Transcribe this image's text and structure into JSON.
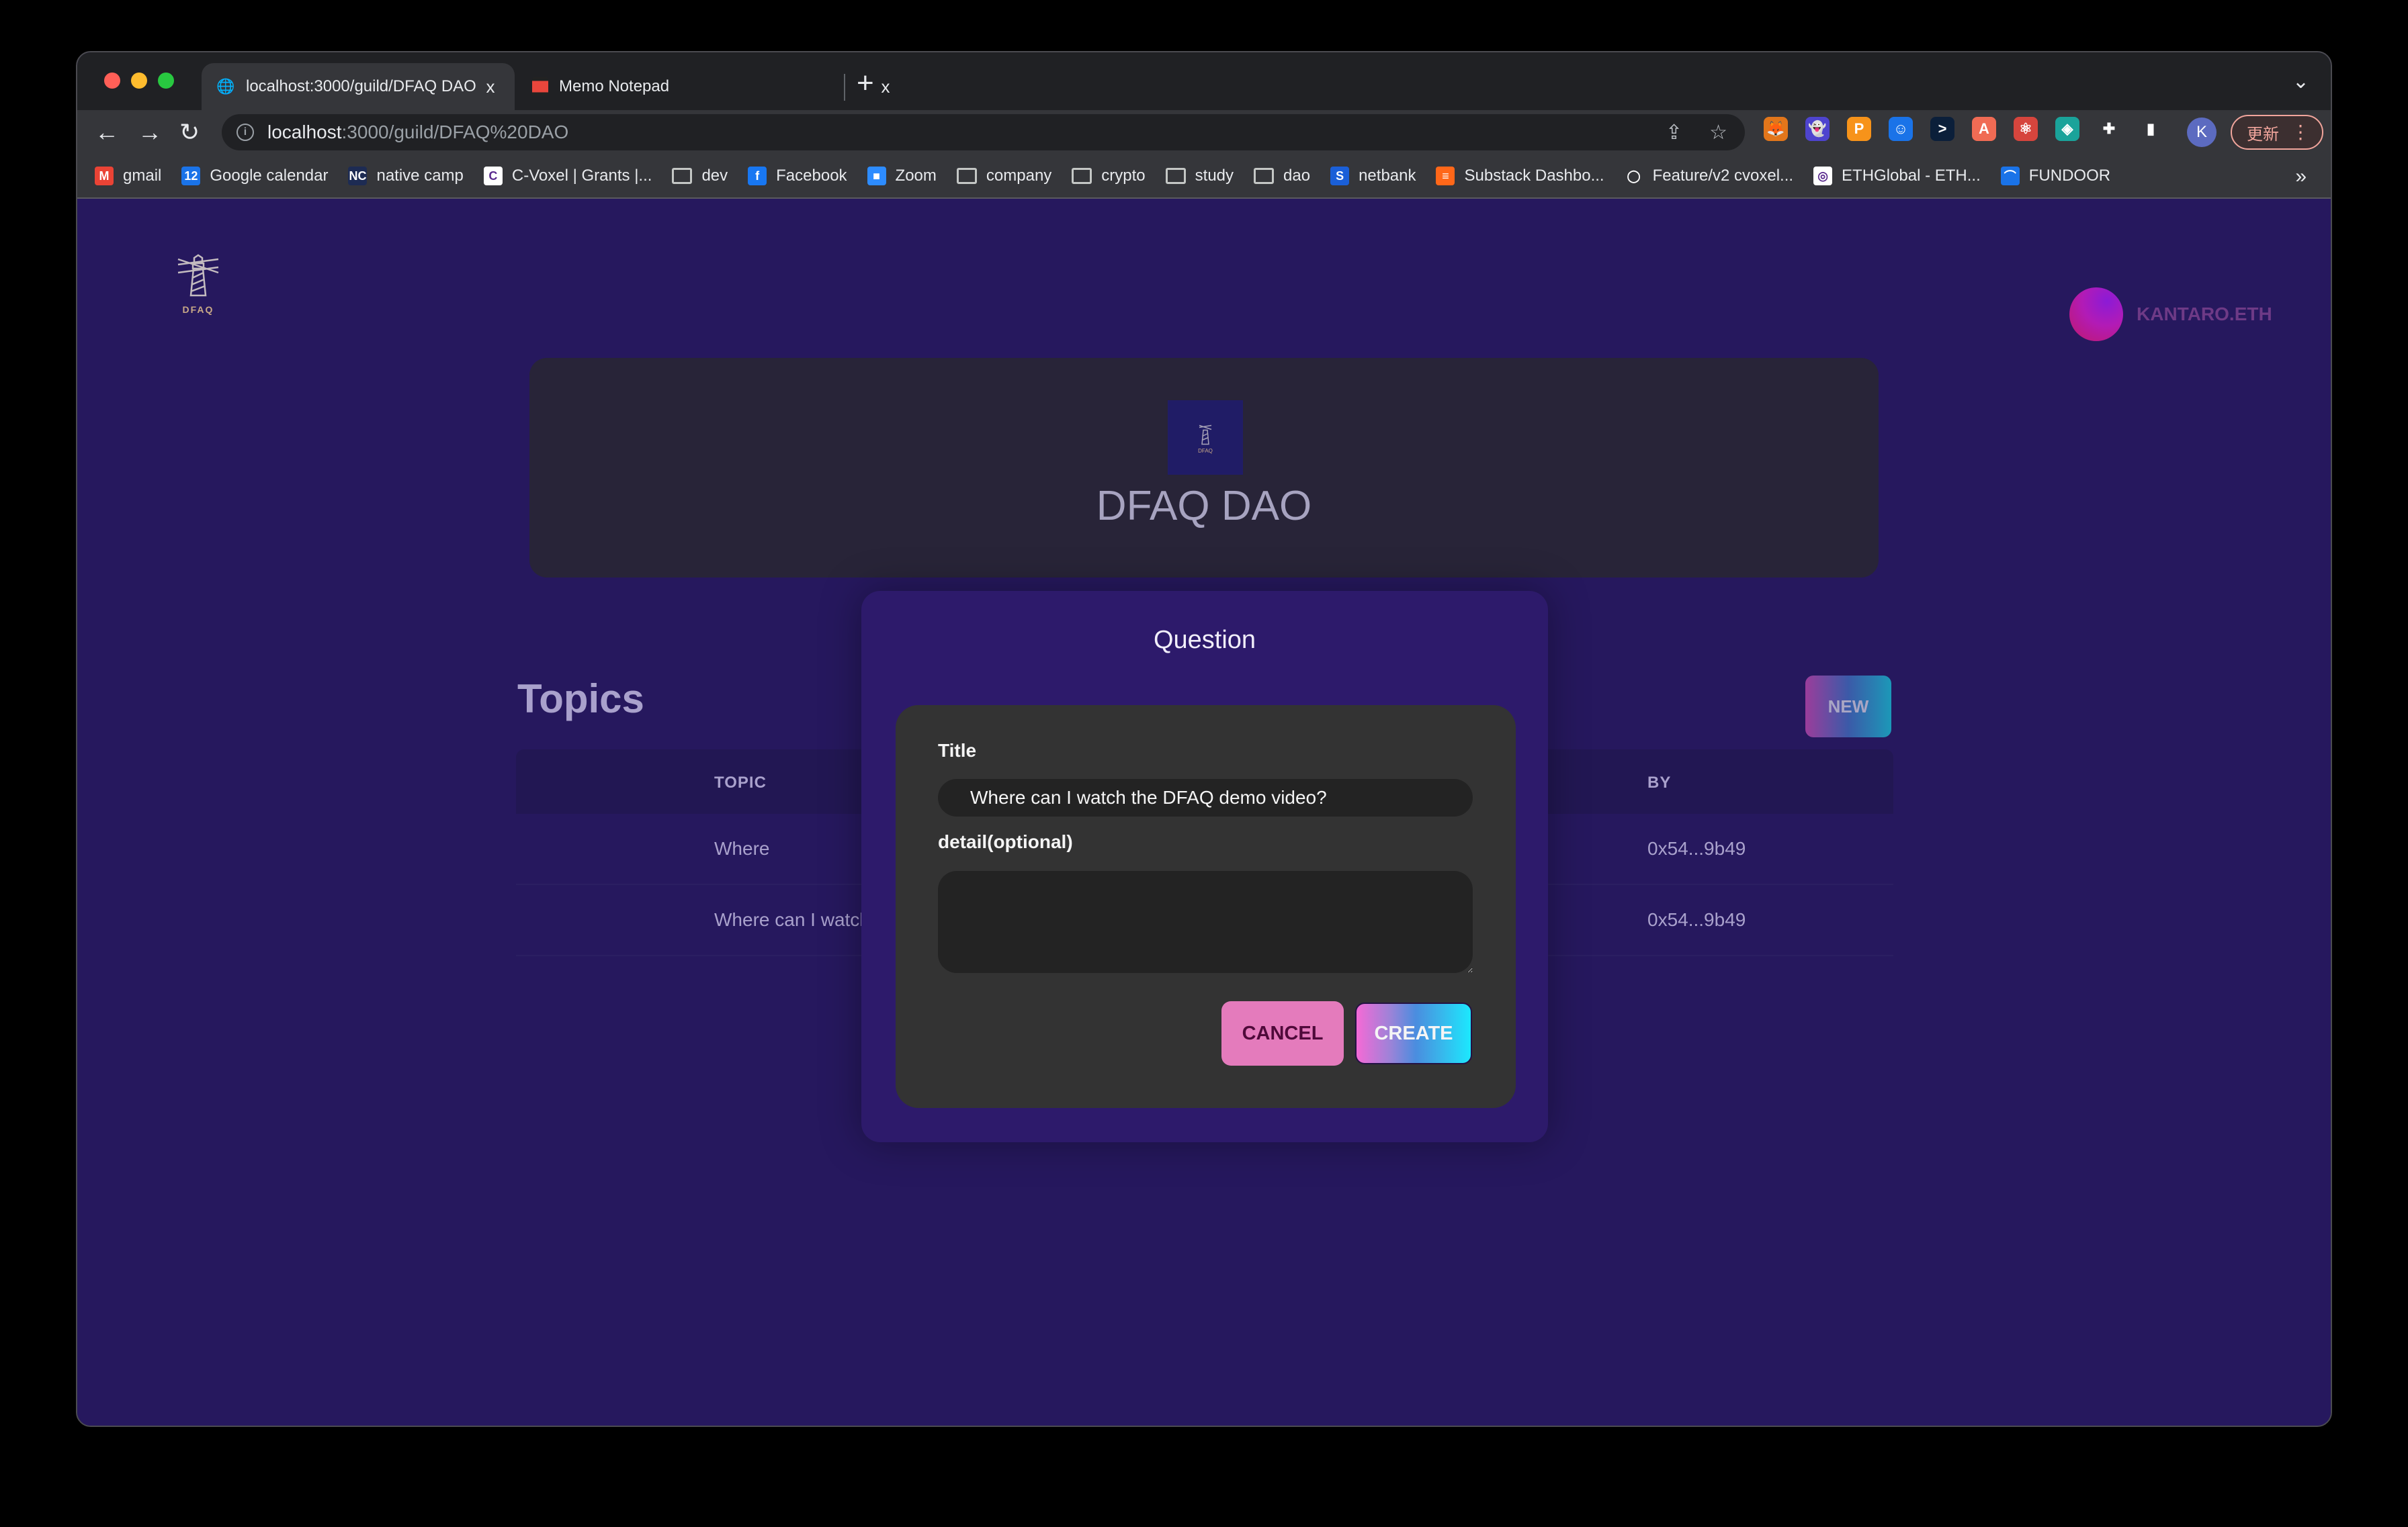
{
  "browser": {
    "tabs": [
      {
        "title": "localhost:3000/guild/DFAQ DAO",
        "active": true,
        "icon": "globe-icon"
      },
      {
        "title": "Memo Notepad",
        "active": false,
        "icon": "memo-notepad-icon"
      }
    ],
    "new_tab_label": "+",
    "tab_close_label": "x",
    "address": {
      "host": "localhost",
      "path": ":3000/guild/DFAQ%20DAO"
    },
    "update_button_label": "更新",
    "profile_initial": "K",
    "extensions": [
      {
        "name": "metamask-icon",
        "glyph": "🦊",
        "color": "#e2761b"
      },
      {
        "name": "phantom-icon",
        "glyph": "👻",
        "color": "#4e44ce"
      },
      {
        "name": "polkadot-icon",
        "glyph": "P",
        "color": "#f7931a"
      },
      {
        "name": "smiley-extension-icon",
        "glyph": "☺",
        "color": "#1a73e8"
      },
      {
        "name": "code-extension-icon",
        "glyph": ">",
        "color": "#0b1f3a"
      },
      {
        "name": "arweave-icon",
        "glyph": "A",
        "color": "#f06b54"
      },
      {
        "name": "react-devtools-icon",
        "glyph": "⚛",
        "color": "#d6453d"
      },
      {
        "name": "web-extension-icon",
        "glyph": "◈",
        "color": "#1aa39a"
      },
      {
        "name": "puzzle-extensions-icon",
        "glyph": "✚",
        "color": "#35363a"
      },
      {
        "name": "sidepanel-icon",
        "glyph": "▮",
        "color": "#35363a"
      }
    ],
    "bookmarks": [
      {
        "label": "gmail",
        "icon": "gmail-icon",
        "glyph": "M",
        "color": "#ea4335"
      },
      {
        "label": "Google calendar",
        "icon": "google-calendar-icon",
        "glyph": "12",
        "color": "#1a73e8"
      },
      {
        "label": "native camp",
        "icon": "native-camp-icon",
        "glyph": "NC",
        "color": "#1d2b53"
      },
      {
        "label": "C-Voxel | Grants |...",
        "icon": "c-voxel-icon",
        "glyph": "C",
        "color": "#ffffff"
      },
      {
        "label": "dev",
        "icon": "folder-icon",
        "folder": true
      },
      {
        "label": "Facebook",
        "icon": "facebook-icon",
        "glyph": "f",
        "color": "#1877f2"
      },
      {
        "label": "Zoom",
        "icon": "zoom-icon",
        "glyph": "■",
        "color": "#2d8cff"
      },
      {
        "label": "company",
        "icon": "folder-icon",
        "folder": true
      },
      {
        "label": "crypto",
        "icon": "folder-icon",
        "folder": true
      },
      {
        "label": "study",
        "icon": "folder-icon",
        "folder": true
      },
      {
        "label": "dao",
        "icon": "folder-icon",
        "folder": true
      },
      {
        "label": "netbank",
        "icon": "netbank-icon",
        "glyph": "S",
        "color": "#1a5fd8"
      },
      {
        "label": "Substack Dashbo...",
        "icon": "substack-icon",
        "glyph": "≡",
        "color": "#ff6719"
      },
      {
        "label": "Feature/v2 cvoxel...",
        "icon": "github-icon",
        "glyph": "◯",
        "color": "#35363a"
      },
      {
        "label": "ETHGlobal - ETH...",
        "icon": "ethglobal-icon",
        "glyph": "◎",
        "color": "#ffffff"
      },
      {
        "label": "FUNDOOR",
        "icon": "fundoor-icon",
        "glyph": "⌒",
        "color": "#1a73e8"
      }
    ],
    "bookmarks_overflow": "»"
  },
  "site": {
    "logo_text": "DFAQ",
    "wallet_name": "KANTARO.ETH"
  },
  "guild": {
    "name": "DFAQ DAO",
    "logo_text": "DFAQ"
  },
  "topics": {
    "title": "Topics",
    "new_button": "NEW",
    "columns": {
      "topic": "TOPIC",
      "by": "BY"
    },
    "rows": [
      {
        "topic": "Where",
        "by": "0x54...9b49"
      },
      {
        "topic": "Where can I watch the DF.",
        "by": "0x54...9b49"
      }
    ]
  },
  "modal": {
    "title": "Question",
    "title_label": "Title",
    "title_value": "Where can I watch the DFAQ demo video?",
    "detail_label": "detail(optional)",
    "detail_value": "",
    "cancel_label": "CANCEL",
    "create_label": "CREATE"
  }
}
